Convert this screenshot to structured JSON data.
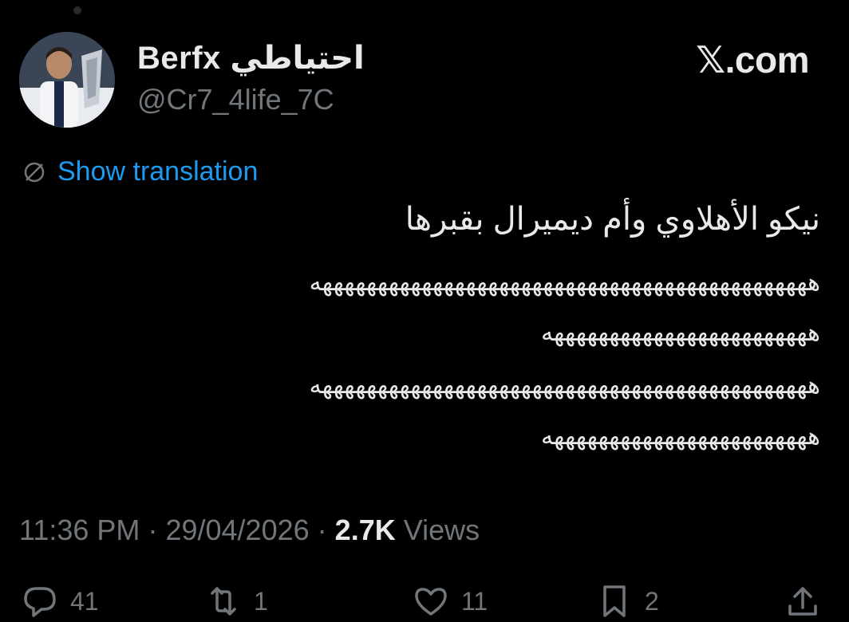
{
  "header": {
    "display_name": "Berfx احتياطي",
    "handle": "@Cr7_4life_7C",
    "brand": "𝕏.com"
  },
  "translation": {
    "label": "Show translation",
    "icon": "globe-slash-icon",
    "color": "#1d9bf0"
  },
  "tweet": {
    "line1": "نيكو الأهلاوي وأم ديميرال بقبرها",
    "laugh_lines": [
      "هههههههههههههههههههههههههههههههههههههههههههههه",
      "ههههههههههههههههههههههههه",
      "هههههههههههههههههههههههههههههههههههههههههههههه",
      "ههههههههههههههههههههههههه"
    ]
  },
  "meta": {
    "time": "11:36 PM",
    "separator": "·",
    "date": "29/04/2026",
    "views_count": "2.7K",
    "views_label": "Views"
  },
  "actions": {
    "reply_count": "41",
    "retweet_count": "1",
    "like_count": "11",
    "bookmark_count": "2"
  },
  "colors": {
    "background": "#000000",
    "text": "#e7e9ea",
    "secondary": "#71767b",
    "accent": "#1d9bf0"
  }
}
